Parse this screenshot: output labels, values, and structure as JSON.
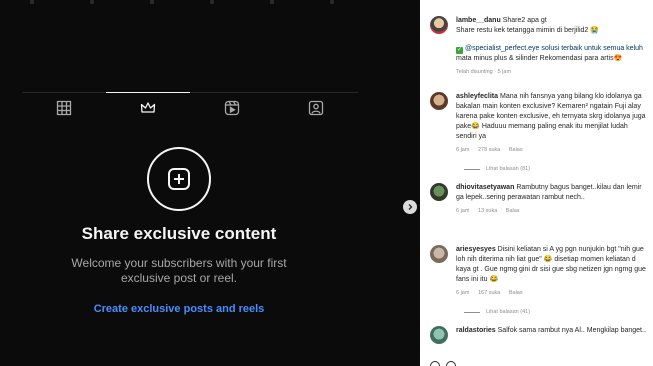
{
  "media": {
    "tabs": [
      {
        "name": "grid",
        "icon": "grid-icon"
      },
      {
        "name": "exclusive",
        "icon": "crown-icon"
      },
      {
        "name": "reels",
        "icon": "reels-icon"
      },
      {
        "name": "tagged",
        "icon": "tagged-icon"
      }
    ],
    "active_tab": "exclusive",
    "title": "Share exclusive content",
    "description": "Welcome your subscribers with your first exclusive post or reel.",
    "cta": "Create exclusive posts and reels"
  },
  "comments": [
    {
      "username": "lambe__danu",
      "inline": "Share2 apa gt",
      "lines": [
        "Share restu kek tetangga mimin di berjilid2 😭",
        "",
        "@specialist_perfect.eye solusi terbaik untuk semua keluh",
        "mata minus plus & silinder Rekomendasi para artis😍"
      ],
      "meta": [
        "Telah disunting · 5 jam"
      ],
      "replies": ""
    },
    {
      "username": "ashleyfeclita",
      "inline": "Mana nih fansnya yang bilang klo idolanya ga",
      "lines": [
        "bakalan main konten exclusive? Kemaren² ngatain Fuji alay",
        "karena pake konten exclusive, eh ternyata skrg idolanya juga",
        "pake😂 Haduuu memang paling enak itu menjilat ludah",
        "sendiri ya"
      ],
      "meta": [
        "6 jam",
        "278 suka",
        "Balas"
      ],
      "replies": "Lihat balasan (81)"
    },
    {
      "username": "dhiovitasetyawan",
      "inline": "Rambutny bagus banget..kilau dan lemir",
      "lines": [
        "ga lepek..sering perawatan rambut nech.."
      ],
      "meta": [
        "6 jam",
        "13 suka",
        "Balas"
      ],
      "replies": ""
    },
    {
      "username": "ariesyesyes",
      "inline": "Disini keliatan si A yg pgn nunjukin bgt \"nih gue",
      "lines": [
        "loh nih diterima nih liat gue\" 😂 disetiap momen keliatan d",
        "kaya gt . Gue ngmg gini dr sisi gue sbg netizen jgn ngmg gue",
        "fans ini itu 😂"
      ],
      "meta": [
        "6 jam",
        "167 suka",
        "Balas"
      ],
      "replies": "Lihat balasan (41)"
    },
    {
      "username": "raldastories",
      "inline": "Salfok sama rambut nya Al.. Mengkilap banget..",
      "lines": [],
      "meta": [],
      "replies": ""
    }
  ],
  "colors": {
    "media_bg": "#0b0b0b",
    "link_blue": "#4a8cff",
    "text_dark": "#262626",
    "text_muted": "#8e8e8e"
  }
}
